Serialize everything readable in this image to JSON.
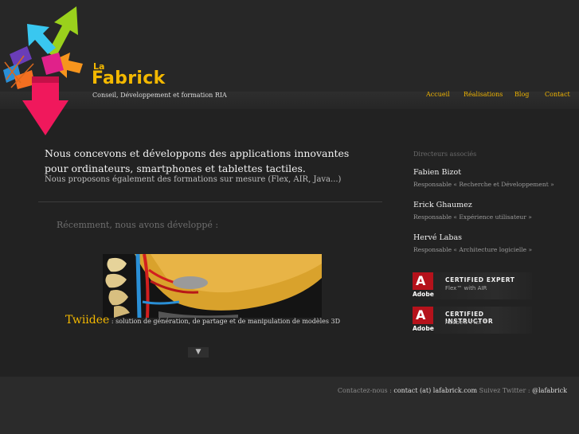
{
  "brand": {
    "la": "La",
    "name": "Fabrick",
    "tagline": "Conseil, Développement et formation RIA"
  },
  "nav": {
    "items": [
      {
        "label": "Accueil"
      },
      {
        "label": "Réalisations"
      },
      {
        "label": "Blog"
      },
      {
        "label": "Contact"
      }
    ]
  },
  "intro": {
    "headline": "Nous concevons et développons des applications innovantes pour ordinateurs, smartphones et tablettes tactiles.",
    "subline": "Nous proposons également des formations sur mesure (Flex, AIR, Java...)"
  },
  "recent": {
    "heading": "Récemment, nous avons développé :",
    "project_title": "Twiidee",
    "project_desc": " : solution de génération, de partage et de manipulation de modèles 3D",
    "next_glyph": "▼"
  },
  "sidebar": {
    "title": "Directeurs associés",
    "people": [
      {
        "name": "Fabien Bizot",
        "role": "Responsable « Recherche et Développement »"
      },
      {
        "name": "Erick Ghaumez",
        "role": "Responsable « Expérience utilisateur »"
      },
      {
        "name": "Hervé Labas",
        "role": "Responsable « Architecture logicielle »"
      }
    ],
    "certs": [
      {
        "mark": "A",
        "brand": "Adobe",
        "line1": "CERTIFIED EXPERT",
        "line2": "Flex™ with AIR"
      },
      {
        "mark": "A",
        "brand": "Adobe",
        "line1": "CERTIFIED INSTRUCTOR",
        "line2": "Adobe® Flex™"
      }
    ]
  },
  "footer": {
    "contact_label": "Contactez-nous : ",
    "contact_value": "contact (at) lafabrick.com",
    "twitter_label": " Suivez Twitter : ",
    "twitter_value": "@lafabrick"
  },
  "colors": {
    "accent": "#f3b800",
    "background": "#232323",
    "adobe_red": "#b5121b"
  }
}
